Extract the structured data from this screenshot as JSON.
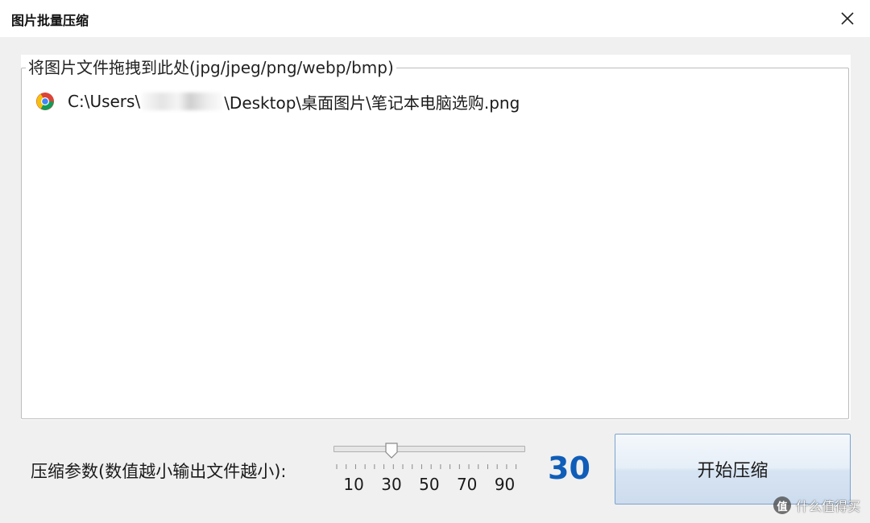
{
  "window": {
    "title": "图片批量压缩"
  },
  "drop_area": {
    "legend": "将图片文件拖拽到此处(jpg/jpeg/png/webp/bmp)",
    "files": [
      {
        "icon": "chrome-icon",
        "path_prefix": "C:\\Users\\",
        "path_suffix": "\\Desktop\\桌面图片\\笔记本电脑选购.png"
      }
    ]
  },
  "compression": {
    "label": "压缩参数(数值越小输出文件越小):",
    "min": 1,
    "max": 100,
    "value": 30,
    "value_display": "30",
    "tick_labels": [
      "10",
      "30",
      "50",
      "70",
      "90"
    ]
  },
  "start_button": {
    "label": "开始压缩"
  },
  "watermark": {
    "logo": "值",
    "text": "什么值得买"
  },
  "colors": {
    "value_display": "#0f5db8",
    "button_border": "#7aa3cf"
  }
}
